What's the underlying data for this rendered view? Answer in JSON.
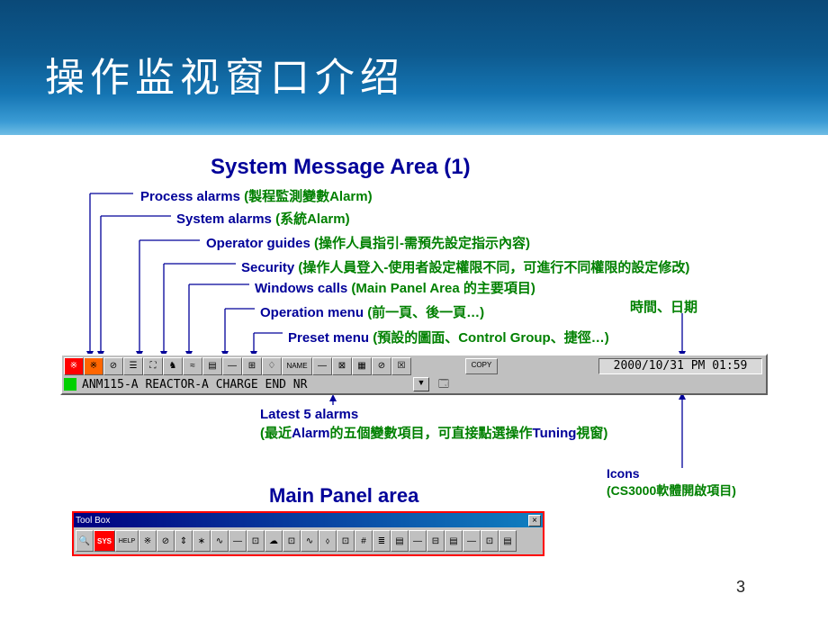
{
  "header": {
    "title": "操作监视窗口介绍"
  },
  "sys_title": "System Message Area (1)",
  "callouts": {
    "c1_pre": "Process alarms ",
    "c1_par": "(製程監測變數Alarm)",
    "c2_pre": "System alarms ",
    "c2_par": "(系統Alarm)",
    "c3_pre": "Operator guides ",
    "c3_par": "(操作人員指引-需預先設定指示內容)",
    "c4_pre": "Security ",
    "c4_par": "(操作人員登入-使用者設定權限不同，可進行不同權限的設定修改)",
    "c5_pre": "Windows calls ",
    "c5_par": "(Main Panel Area 的主要項目)",
    "c6_pre": "Operation menu ",
    "c6_par": "(前一頁、後一頁…)",
    "c7_pre": "Preset  menu ",
    "c7_par": "(預設的圖面、Control Group、捷徑…)"
  },
  "datetime_label": "時間、日期",
  "toolbar": {
    "copy": "COPY",
    "datetime": "2000/10/31 PM 01:59",
    "alarm_text": "ANM115-A    REACTOR-A CHARGE END    NR",
    "dropdown": "▼",
    "icons": [
      "※",
      "※",
      "⊘",
      "☰",
      "⛶",
      "♞",
      "≈",
      "▤",
      "—",
      "⊞",
      "♢",
      "NAME",
      "—",
      "⊠",
      "▦",
      "⊘",
      "☒"
    ]
  },
  "latest": {
    "line1_en": "Latest 5 alarms",
    "line2_a": "(最近",
    "line2_b": "Alarm",
    "line2_c": "的五個變數項目，可直接點選操作",
    "line2_d": "Tuning",
    "line2_e": "視窗)"
  },
  "icons_note": {
    "t1": "Icons",
    "t2": "(CS3000軟體開啟項目)"
  },
  "main_panel_title": "Main Panel area",
  "toolbox": {
    "title": "Tool Box",
    "close": "×",
    "items": [
      "🔍",
      "SYS",
      "HELP",
      "※",
      "⊘",
      "⇕",
      "∗",
      "∿",
      "—",
      "⊡",
      "☁",
      "⊡",
      "∿",
      "⬨",
      "⊡",
      "#",
      "≣",
      "▤",
      "—",
      "⊟",
      "▤",
      "—",
      "⊡",
      "▤"
    ]
  },
  "page": "3"
}
